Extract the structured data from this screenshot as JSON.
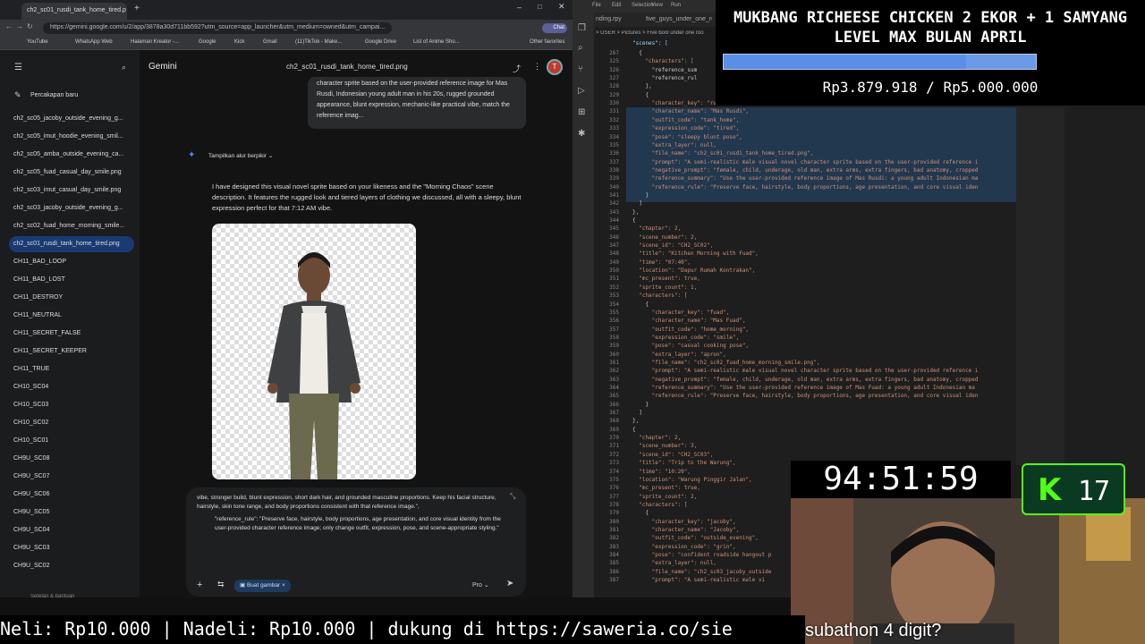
{
  "browser": {
    "tab_title": "ch2_sc01_rusdi_tank_home_tired.p",
    "url": "https://gemini.google.com/u/2/app/3878a30d711bb592?utm_source=app_launcher&utm_medium=owned&utm_campai...",
    "bookmarks": [
      "YouTube",
      "WhatsApp Web",
      "Halaman Kreator -...",
      "Google",
      "Kick",
      "Gmail",
      "(11)TikTok - Make...",
      "Google Drive",
      "List of Anime Sho...",
      "Other favorites"
    ],
    "profile_label": "Chat"
  },
  "gemini": {
    "app_name": "Gemini",
    "chat_title": "ch2_sc01_rusdi_tank_home_tired.png",
    "new_chat": "Percakapan baru",
    "user_initial": "T",
    "sidebar_items": [
      "ch2_sc05_jacoby_outside_evening_g...",
      "ch2_sc05_imut_hoodie_evening_smil...",
      "ch2_sc05_amba_outside_evening_ca...",
      "ch2_sc05_fuad_casual_day_smile.png",
      "ch2_sc03_imut_casual_day_smile.png",
      "ch2_sc03_jacoby_outside_evening_g...",
      "ch2_sc02_fuad_home_morning_smile...",
      "ch2_sc01_rusdi_tank_home_tired.png",
      "CH11_BAD_LOOP",
      "CH11_BAD_LOST",
      "CH11_DESTROY",
      "CH11_NEUTRAL",
      "CH11_SECRET_FALSE",
      "CH11_SECRET_KEEPER",
      "CH11_TRUE",
      "CH10_SC04",
      "CH10_SC03",
      "CH10_SC02",
      "CH10_SC01",
      "CH9U_SC08",
      "CH9U_SC07",
      "CH9U_SC06",
      "CH9U_SC05",
      "CH9U_SC04",
      "CH9U_SC03",
      "CH9U_SC02"
    ],
    "settings_label": "Setelan & bantuan",
    "user_message": "character sprite based on the user-provided reference image for Mas Rusdi, Indonesian young adult man in his 20s, rugged grounded appearance, blunt expression, mechanic-like practical vibe, match the reference imag...",
    "thinking_label": "Tampilkan alur berpikir",
    "answer": "I have designed this visual novel sprite based on your likeness and the \"Morning Chaos\" scene description. It features the rugged look and tiered layers of clothing we discussed, all with a sleepy, blunt expression perfect for that 7:12 AM vibe.",
    "input_text_1": "vibe, stronger build, blunt expression, short dark hair, and grounded masculine proportions. Keep his facial structure, hairstyle, skin tone range, and body proportions consistent with that reference image.\",",
    "input_text_2": "\"reference_rule\": \"Preserve face, hairstyle, body proportions, age presentation, and core visual identity from the user-provided character reference image; only change outfit, expression, pose, and scene-appropriate styling.\"",
    "tool_chip": "Buat gambar",
    "model_label": "Pro"
  },
  "editor": {
    "menu": [
      "File",
      "Edit",
      "Selection",
      "View",
      "Run"
    ],
    "tabs": [
      "nding.rpy",
      "five_guys_under_one_roo"
    ],
    "breadcrumb": "> USER > Pictures > Five bool under one roo",
    "scenes_key": "\"scenes\": [",
    "line_numbers": [
      "267",
      "325",
      "326",
      "327",
      "328",
      "329",
      "330",
      "331",
      "332",
      "333",
      "334",
      "335",
      "336",
      "337",
      "338",
      "339",
      "340",
      "341",
      "342",
      "343",
      "344",
      "345",
      "346",
      "347",
      "348",
      "349",
      "350",
      "351",
      "352",
      "353",
      "354",
      "355",
      "356",
      "357",
      "358",
      "359",
      "360",
      "361",
      "362",
      "363",
      "364",
      "365",
      "366",
      "367",
      "368",
      "369",
      "370",
      "371",
      "372",
      "373",
      "374",
      "375",
      "376",
      "377",
      "378",
      "379",
      "380",
      "381",
      "382",
      "383",
      "384",
      "385",
      "386",
      "387"
    ],
    "code_lines": [
      "  {",
      "    \"characters\": [",
      "      \"reference_sum",
      "      \"reference_rul",
      "    },",
      "    {",
      "      \"character_key\": \"rusdi\",",
      "      \"character_name\": \"Mas Rusdi\",",
      "      \"outfit_code\": \"tank_home\",",
      "      \"expression_code\": \"tired\",",
      "      \"pose\": \"sleepy blunt pose\",",
      "      \"extra_layer\": null,",
      "      \"file_name\": \"ch2_sc01_rusdi_tank_home_tired.png\",",
      "      \"prompt\": \"A semi-realistic male visual novel character sprite based on the user-provided reference i",
      "      \"negative_prompt\": \"female, child, underage, old man, extra arms, extra fingers, bad anatomy, cropped",
      "      \"reference_summary\": \"Use the user-provided reference image of Mas Rusdi: a young adult Indonesian ma",
      "      \"reference_rule\": \"Preserve face, hairstyle, body proportions, age presentation, and core visual iden",
      "    }",
      "  ]",
      "},",
      "{",
      "  \"chapter\": 2,",
      "  \"scene_number\": 2,",
      "  \"scene_id\": \"CH2_SC02\",",
      "  \"title\": \"Kitchen Morning with Fuad\",",
      "  \"time\": \"07:40\",",
      "  \"location\": \"Dapur Rumah Kontrakan\",",
      "  \"mc_present\": true,",
      "  \"sprite_count\": 1,",
      "  \"characters\": [",
      "    {",
      "      \"character_key\": \"fuad\",",
      "      \"character_name\": \"Mas Fuad\",",
      "      \"outfit_code\": \"home_morning\",",
      "      \"expression_code\": \"smile\",",
      "      \"pose\": \"casual cooking pose\",",
      "      \"extra_layer\": \"apron\",",
      "      \"file_name\": \"ch2_sc02_fuad_home_morning_smile.png\",",
      "      \"prompt\": \"A semi-realistic male visual novel character sprite based on the user-provided reference i",
      "      \"negative_prompt\": \"female, child, underage, old man, extra arms, extra fingers, bad anatomy, cropped",
      "      \"reference_summary\": \"Use the user-provided reference image of Mas Fuad: a young adult Indonesian ma",
      "      \"reference_rule\": \"Preserve face, hairstyle, body proportions, age presentation, and core visual iden",
      "    }",
      "  ]",
      "},",
      "{",
      "  \"chapter\": 2,",
      "  \"scene_number\": 3,",
      "  \"scene_id\": \"CH2_SC03\",",
      "  \"title\": \"Trip to the Warung\",",
      "  \"time\": \"10:20\",",
      "  \"location\": \"Warung Pinggir Jalan\",",
      "  \"mc_present\": true,",
      "  \"sprite_count\": 2,",
      "  \"characters\": [",
      "    {",
      "      \"character_key\": \"jacoby\",",
      "      \"character_name\": \"Jacoby\",",
      "      \"outfit_code\": \"outside_evening\",",
      "      \"expression_code\": \"grin\",",
      "      \"pose\": \"confident roadside hangout p",
      "      \"extra_layer\": null,",
      "      \"file_name\": \"ch2_sc03_jacoby_outside",
      "      \"prompt\": \"A semi-realistic male vi"
    ]
  },
  "overlay": {
    "donation_title": "MUKBANG RICHEESE CHICKEN 2 EKOR + 1 SAMYANG LEVEL MAX BULAN APRIL",
    "donation_amount": "Rp3.879.918 / Rp5.000.000",
    "donation_progress": 0.776,
    "timer": "94:51:59",
    "kick_count": "17",
    "ticker": "Neli: Rp10.000 | Nadeli: Rp10.000 |  dukung di https://saweria.co/sie",
    "subtitle": "subathon 4 digit?"
  },
  "colors": {
    "kick_green": "#53fc18",
    "active_item": "#1a3a73",
    "progress": "#5b8ee6"
  }
}
